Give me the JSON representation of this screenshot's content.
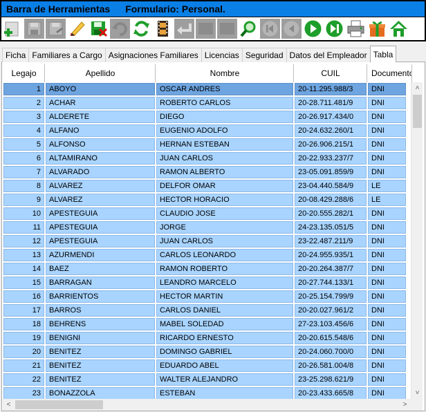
{
  "title": {
    "toolbar_title": "Barra de Herramientas",
    "form_title": "Formulario: Personal."
  },
  "toolbar": {
    "buttons": [
      {
        "name": "add-icon",
        "enabled": true
      },
      {
        "name": "save-icon",
        "enabled": false
      },
      {
        "name": "save-as-icon",
        "enabled": false
      },
      {
        "name": "edit-pencil-icon",
        "enabled": true
      },
      {
        "name": "delete-save-icon",
        "enabled": true
      },
      {
        "name": "undo-icon",
        "enabled": false
      },
      {
        "name": "refresh-icon",
        "enabled": true
      },
      {
        "name": "film-icon",
        "enabled": true
      },
      {
        "name": "return-arrow-icon",
        "enabled": false
      },
      {
        "name": "blank-icon",
        "enabled": false
      },
      {
        "name": "blank-icon-2",
        "enabled": false
      },
      {
        "name": "search-icon",
        "enabled": true
      },
      {
        "name": "first-record-icon",
        "enabled": false
      },
      {
        "name": "previous-record-icon",
        "enabled": false
      },
      {
        "name": "next-record-icon",
        "enabled": true
      },
      {
        "name": "last-record-icon",
        "enabled": true
      },
      {
        "name": "printer-icon",
        "enabled": true
      },
      {
        "name": "gift-icon",
        "enabled": true
      },
      {
        "name": "home-icon",
        "enabled": true
      }
    ],
    "colors": {
      "green": "#1e9e2a",
      "disabled": "#9e9e9e"
    }
  },
  "tabs": [
    "Ficha",
    "Familiares a Cargo",
    "Asignaciones Familiares",
    "Licencias",
    "Seguridad",
    "Datos del Empleador",
    "Tabla"
  ],
  "active_tab": "Tabla",
  "table": {
    "columns": [
      "Legajo",
      "Apellido",
      "Nombre",
      "CUIL",
      "Documento"
    ],
    "rows": [
      [
        "1",
        "ABOYO",
        "OSCAR ANDRES",
        "20-11.295.988/3",
        "DNI"
      ],
      [
        "2",
        "ACHAR",
        "ROBERTO CARLOS",
        "20-28.711.481/9",
        "DNI"
      ],
      [
        "3",
        "ALDERETE",
        "DIEGO",
        "20-26.917.434/0",
        "DNI"
      ],
      [
        "4",
        "ALFANO",
        "EUGENIO ADOLFO",
        "20-24.632.260/1",
        "DNI"
      ],
      [
        "5",
        "ALFONSO",
        "HERNAN ESTEBAN",
        "20-26.906.215/1",
        "DNI"
      ],
      [
        "6",
        "ALTAMIRANO",
        "JUAN CARLOS",
        "20-22.933.237/7",
        "DNI"
      ],
      [
        "7",
        "ALVARADO",
        "RAMON ALBERTO",
        "23-05.091.859/9",
        "DNI"
      ],
      [
        "8",
        "ALVAREZ",
        "DELFOR OMAR",
        "23-04.440.584/9",
        "LE"
      ],
      [
        "9",
        "ALVAREZ",
        "HECTOR HORACIO",
        "20-08.429.288/6",
        "LE"
      ],
      [
        "10",
        "APESTEGUIA",
        "CLAUDIO JOSE",
        "20-20.555.282/1",
        "DNI"
      ],
      [
        "11",
        "APESTEGUIA",
        "JORGE",
        "24-23.135.051/5",
        "DNI"
      ],
      [
        "12",
        "APESTEGUIA",
        "JUAN CARLOS",
        "23-22.487.211/9",
        "DNI"
      ],
      [
        "13",
        "AZURMENDI",
        "CARLOS LEONARDO",
        "20-24.955.935/1",
        "DNI"
      ],
      [
        "14",
        "BAEZ",
        "RAMON ROBERTO",
        "20-20.264.387/7",
        "DNI"
      ],
      [
        "15",
        "BARRAGAN",
        "LEANDRO MARCELO",
        "20-27.744.133/1",
        "DNI"
      ],
      [
        "16",
        "BARRIENTOS",
        "HECTOR MARTIN",
        "20-25.154.799/9",
        "DNI"
      ],
      [
        "17",
        "BARROS",
        "CARLOS DANIEL",
        "20-20.027.961/2",
        "DNI"
      ],
      [
        "18",
        "BEHRENS",
        "MABEL SOLEDAD",
        "27-23.103.456/6",
        "DNI"
      ],
      [
        "19",
        "BENIGNI",
        "RICARDO ERNESTO",
        "20-20.615.548/6",
        "DNI"
      ],
      [
        "20",
        "BENITEZ",
        "DOMINGO GABRIEL",
        "20-24.060.700/0",
        "DNI"
      ],
      [
        "21",
        "BENITEZ",
        "EDUARDO ABEL",
        "20-26.581.004/8",
        "DNI"
      ],
      [
        "22",
        "BENITEZ",
        "WALTER ALEJANDRO",
        "23-25.298.621/9",
        "DNI"
      ],
      [
        "23",
        "BONAZZOLA",
        "ESTEBAN",
        "20-23.433.665/8",
        "DNI"
      ]
    ],
    "selected_row": 0,
    "colors": {
      "cell": "#a8d4ff",
      "selected": "#6ea5e0"
    }
  }
}
